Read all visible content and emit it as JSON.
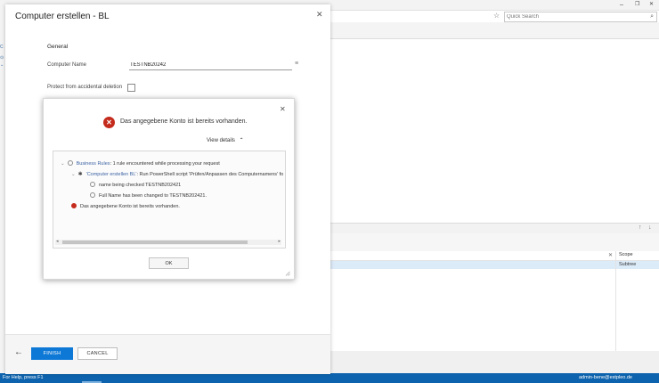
{
  "background": {
    "search_placeholder": "Quick Search",
    "grid_scope_header": "Scope",
    "grid_scope_value": "Subtree",
    "status_help": "For Help, press F1",
    "status_user": "admin-bene@estpleo.de",
    "window_controls": {
      "minimize": "–",
      "maximize": "❐",
      "close": "✕"
    }
  },
  "wizard": {
    "title": "Computer erstellen - BL",
    "section": "General",
    "computer_name_label": "Computer Name",
    "computer_name_value": "TESTNB20242",
    "protect_label": "Protect from accidental deletion",
    "finish_label": "FINISH",
    "cancel_label": "CANCEL",
    "back_glyph": "←"
  },
  "error_dialog": {
    "message": "Das angegebene Konto ist bereits vorhanden.",
    "view_details": "View details",
    "ok_label": "OK",
    "details": {
      "business_rules_link": "Business Rules",
      "business_rules_text": ": 1 rule encountered while processing your request",
      "rule_link": "'Computer erstellen BL'",
      "rule_text": ": Run PowerShell script 'Prüfen/Anpassen des Computernamens' fo",
      "line1": "name being checked TESTNB202421",
      "line2": "Full Name has been changed to TESTNB202421.",
      "error_line": "Das angegebene Konto ist bereits vorhanden."
    }
  }
}
